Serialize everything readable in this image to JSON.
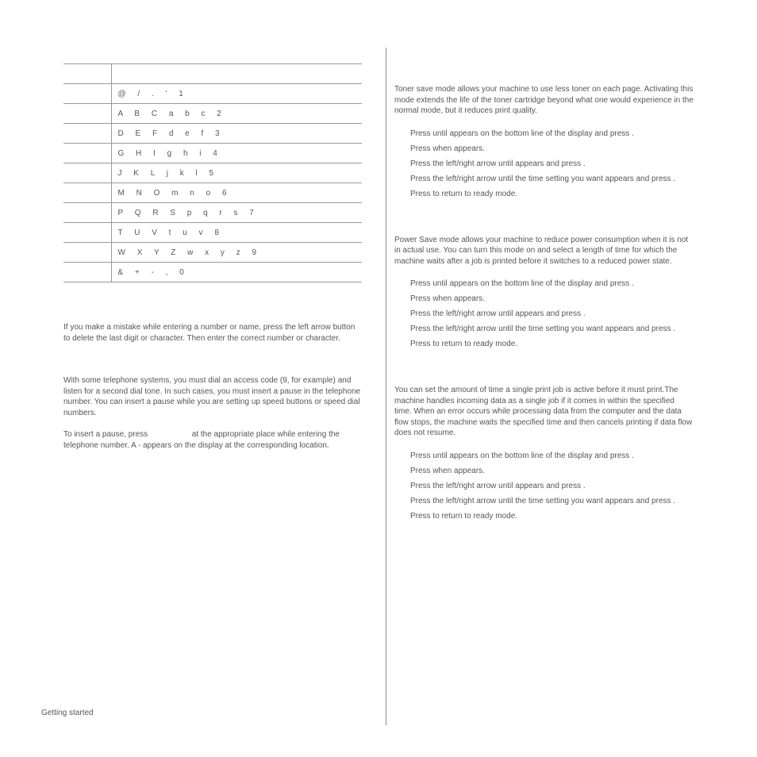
{
  "table": {
    "rows": [
      {
        "key": "",
        "chars": ""
      },
      {
        "key": "",
        "chars": "@  /  .  '  1"
      },
      {
        "key": "",
        "chars": "A  B  C  a  b  c  2"
      },
      {
        "key": "",
        "chars": "D  E  F  d  e  f  3"
      },
      {
        "key": "",
        "chars": "G  H  I  g  h  i  4"
      },
      {
        "key": "",
        "chars": "J  K  L  j  k  l  5"
      },
      {
        "key": "",
        "chars": "M  N  O  m  n  o  6"
      },
      {
        "key": "",
        "chars": "P  Q  R  S  p  q  r  s  7"
      },
      {
        "key": "",
        "chars": "T  U  V  t  u  v  8"
      },
      {
        "key": "",
        "chars": "W  X  Y  Z  w  x  y  z  9"
      },
      {
        "key": "",
        "chars": "&  +  -  ,  0"
      }
    ]
  },
  "left": {
    "p_mistake": "If you make a mistake while entering a number or name, press the left arrow button to delete the last digit or character. Then enter the correct number or character.",
    "p_pause1": "With some telephone systems, you must dial an access code (9, for example) and listen for a second dial tone. In such cases, you must insert a pause in the telephone number. You can insert a pause while you are setting up speed buttons or speed dial numbers.",
    "p_pause2a": "To insert a pause, press",
    "p_pause2b": "at the appropriate place while entering the telephone number. A - appears on the display at the corresponding location."
  },
  "right": {
    "toner_intro": "Toner save mode allows your machine to use less toner on each page. Activating this mode extends the life of the toner cartridge beyond what one would experience in the normal mode, but it reduces print quality.",
    "toner_steps": [
      "Press          until                                      appears on the bottom line of the display and press      .",
      "Press          when                                   appears.",
      "Press the left/right arrow until                               appears and press       .",
      "Press the left/right arrow until the time setting you want appears and press       .",
      "Press                       to return to ready mode."
    ],
    "power_intro": "Power Save mode allows your machine to reduce power consumption when it is not in actual use. You can turn this mode on and select a length of time for which the machine waits after a job is printed before it switches to a reduced power state.",
    "power_steps": [
      "Press          until                                      appears on the bottom line of the display and press      .",
      "Press          when                                   appears.",
      "Press the left/right arrow until                               appears and press       .",
      "Press the left/right arrow until the time setting you want appears and press       .",
      "Press                       to return to ready mode."
    ],
    "timeout_intro": "You can set the amount of time a single print job is active before it must print.The machine handles incoming data as a single job if it comes in within the specified time. When an error occurs while processing data from the computer and the data flow stops, the machine waits the specified time and then cancels printing if data flow does not resume.",
    "timeout_steps": [
      "Press          until                                      appears on the bottom line of the display and press      .",
      "Press          when                                   appears.",
      "Press the left/right arrow until                               appears and press       .",
      "Press the left/right arrow until the time setting you want appears and press       .",
      "Press                       to return to ready mode."
    ]
  },
  "footer": "Getting started"
}
